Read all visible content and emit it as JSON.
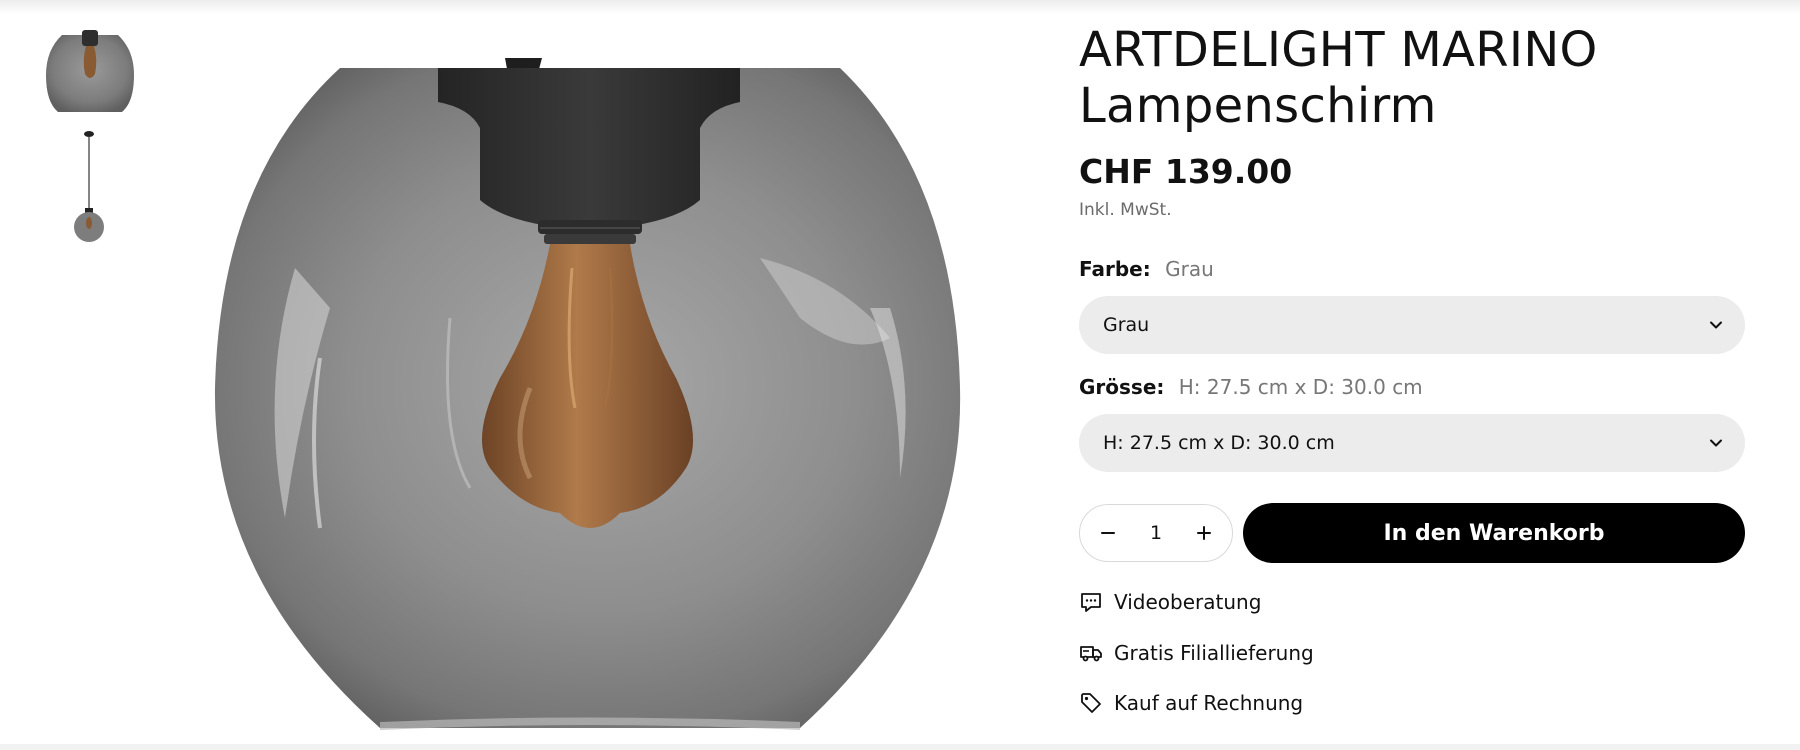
{
  "product": {
    "title_line1": "ARTDELIGHT MARINO",
    "title_line2": "Lampenschirm",
    "price": "CHF 139.00",
    "tax_note": "Inkl. MwSt."
  },
  "options": {
    "color": {
      "label": "Farbe:",
      "selected": "Grau",
      "select_value": "Grau"
    },
    "size": {
      "label": "Grösse:",
      "selected": "H: 27.5 cm x D: 30.0 cm",
      "select_value": "H: 27.5 cm x D: 30.0 cm"
    }
  },
  "purchase": {
    "quantity": "1",
    "add_to_cart_label": "In den Warenkorb"
  },
  "features": [
    {
      "icon": "chat-bubble-icon",
      "label": "Videoberatung"
    },
    {
      "icon": "truck-icon",
      "label": "Gratis Filiallieferung"
    },
    {
      "icon": "tag-icon",
      "label": "Kauf auf Rechnung"
    }
  ],
  "gallery": {
    "thumbnails": [
      "lamp-shade-thumb",
      "pendant-lamp-thumb"
    ],
    "colors": {
      "glass": "#7a7a7a",
      "cap": "#2f2f2f",
      "bulb": "#8a5a33"
    }
  }
}
